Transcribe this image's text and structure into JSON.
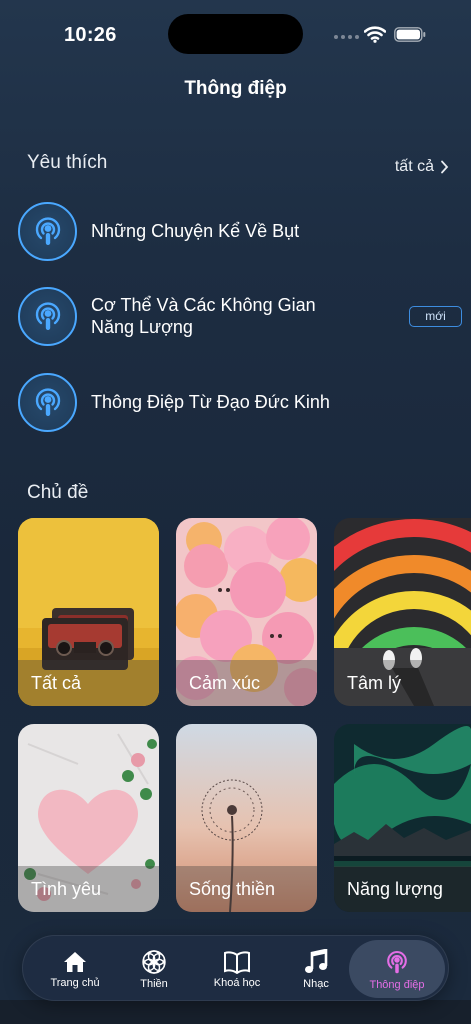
{
  "status": {
    "time": "10:26"
  },
  "header": {
    "title": "Thông điệp"
  },
  "favorites": {
    "title": "Yêu thích",
    "see_all": "tất cả",
    "items": [
      {
        "label": "Những Chuyện Kể Về Bụt"
      },
      {
        "label": "Cơ Thể Và Các Không Gian Năng Lượng",
        "badge": "mới"
      },
      {
        "label": "Thông Điệp Từ Đạo Đức Kinh"
      }
    ]
  },
  "topics": {
    "title": "Chủ đề",
    "items": [
      {
        "label": "Tất cả"
      },
      {
        "label": "Cảm xúc"
      },
      {
        "label": "Tâm lý"
      },
      {
        "label": "Tình yêu"
      },
      {
        "label": "Sống thiền"
      },
      {
        "label": "Năng lượng"
      }
    ]
  },
  "tab_bar": {
    "items": [
      {
        "label": "Trang chủ",
        "icon": "home-icon"
      },
      {
        "label": "Thiền",
        "icon": "lotus-icon"
      },
      {
        "label": "Khoá học",
        "icon": "book-icon"
      },
      {
        "label": "Nhạc",
        "icon": "music-icon"
      },
      {
        "label": "Thông điệp",
        "icon": "podcast-icon",
        "active": true
      }
    ],
    "active_color": "#e46ee6"
  },
  "colors": {
    "accent": "#4aa8ff",
    "background": "#1d2d42"
  }
}
